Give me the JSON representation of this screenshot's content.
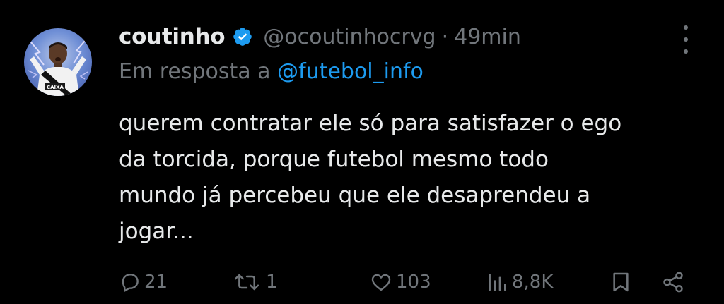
{
  "author": {
    "name": "coutinho",
    "handle": "@ocoutinhocrvg",
    "separator": "·",
    "time": "49min",
    "verified_color": "#1d9bf0"
  },
  "reply": {
    "prefix": "Em resposta a ",
    "mention": "@futebol_info"
  },
  "body": {
    "lines": [
      "querem contratar ele só para satisfazer o ego",
      "da torcida, porque futebol mesmo todo",
      "mundo já percebeu que ele desaprendeu a",
      "jogar..."
    ]
  },
  "actions": {
    "replies": "21",
    "reposts": "1",
    "likes": "103",
    "views": "8,8K"
  },
  "avatar": {
    "jersey_text": "CAIXA"
  },
  "colors": {
    "background": "#000000",
    "text": "#e7e9ea",
    "muted": "#71767b",
    "accent": "#1d9bf0"
  },
  "icons": [
    "verified-badge-icon",
    "more-options-icon",
    "reply-icon",
    "repost-icon",
    "like-icon",
    "views-icon",
    "bookmark-icon",
    "share-icon"
  ]
}
